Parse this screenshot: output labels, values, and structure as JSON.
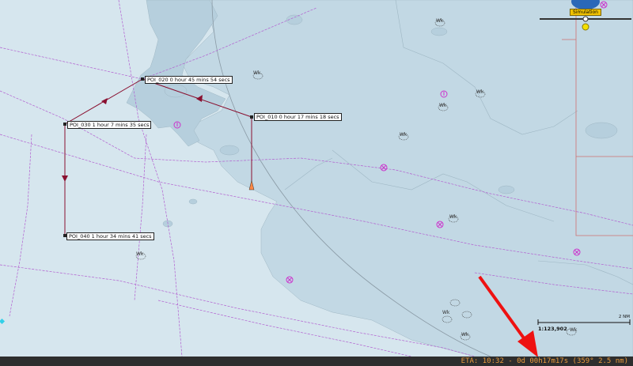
{
  "route": {
    "waypoints": [
      {
        "id": "POI_010",
        "label": "POI_010 0 hour 17 mins 18 secs"
      },
      {
        "id": "POI_020",
        "label": "POI_020 0 hour 45 mins 54 secs"
      },
      {
        "id": "POI_030",
        "label": "POI_030 1 hour 7 mins 35 secs"
      },
      {
        "id": "POI_040",
        "label": "POI_040 1 hour 34 mins 41 secs"
      }
    ],
    "color": "#8a1030"
  },
  "wreck_label": "Wk",
  "simulation": {
    "label": "Simulation"
  },
  "scale": {
    "ratio": "1:123,902",
    "unit": "2 NM"
  },
  "eta": {
    "text": "ETA: 10:32 - 0d 00h17m17s (359° 2.5 nm)"
  },
  "colors": {
    "deep_water": "#d6e6ee",
    "shallow_water": "#b8d2e0",
    "land": "#c9dbe6",
    "route": "#8a1030",
    "track": "#b25fd0",
    "arrow": "#ee1111"
  }
}
